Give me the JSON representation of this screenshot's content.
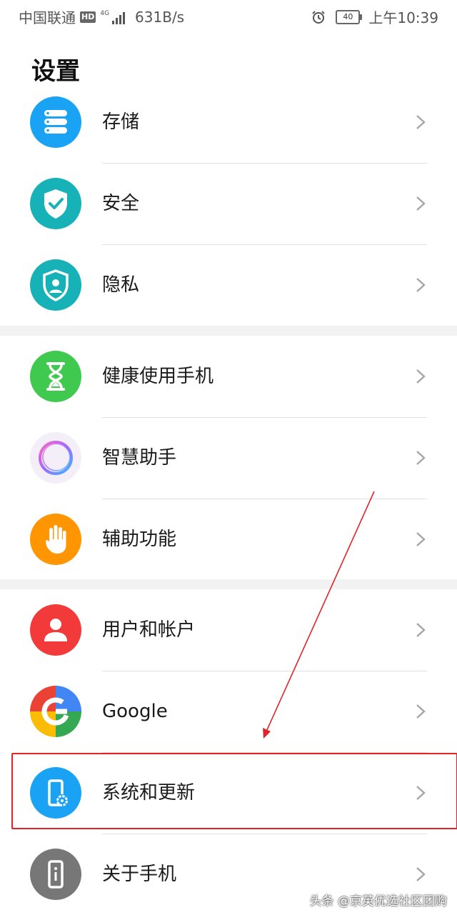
{
  "status_bar": {
    "carrier": "中国联通",
    "hd_badge": "HD",
    "network": "4G",
    "net_speed": "631B/s",
    "battery": "40",
    "time": "上午10:39"
  },
  "page_title": "设置",
  "groups": [
    {
      "items": [
        {
          "label": "存储",
          "icon": "storage-icon",
          "color": "#1aa3f5"
        },
        {
          "label": "安全",
          "icon": "security-shield-icon",
          "color": "#17b2b8"
        },
        {
          "label": "隐私",
          "icon": "privacy-shield-icon",
          "color": "#17b2b8"
        }
      ]
    },
    {
      "items": [
        {
          "label": "健康使用手机",
          "icon": "hourglass-icon",
          "color": "#3fc94f"
        },
        {
          "label": "智慧助手",
          "icon": "smart-assistant-icon",
          "color": "#b266e6"
        },
        {
          "label": "辅助功能",
          "icon": "hand-icon",
          "color": "#ff9500"
        }
      ]
    },
    {
      "items": [
        {
          "label": "用户和帐户",
          "icon": "user-icon",
          "color": "#f23a3a"
        },
        {
          "label": "Google",
          "icon": "google-icon",
          "color": "#4285f4"
        },
        {
          "label": "系统和更新",
          "icon": "phone-settings-icon",
          "color": "#1aa3f5"
        },
        {
          "label": "关于手机",
          "icon": "phone-info-icon",
          "color": "#777777"
        }
      ]
    }
  ],
  "annotation": {
    "color": "#e2242a"
  },
  "watermark": "头条 @京英优选社区团购"
}
